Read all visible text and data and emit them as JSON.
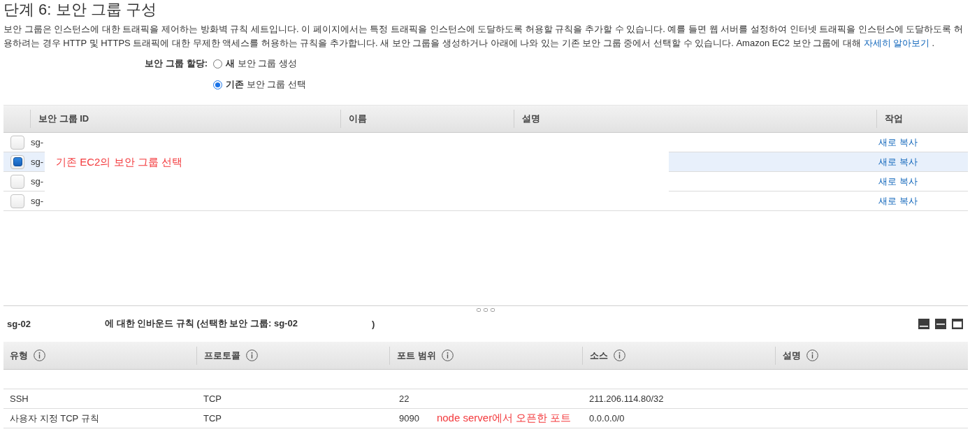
{
  "title": "단계 6: 보안 그룹 구성",
  "description": {
    "text": "보안 그룹은 인스턴스에 대한 트래픽을 제어하는 방화벽 규칙 세트입니다. 이 페이지에서는 특정 트래픽을 인스턴스에 도달하도록 허용할 규칙을 추가할 수 있습니다. 예를 들면 웹 서버를 설정하여 인터넷 트래픽을 인스턴스에 도달하도록 허용하려는 경우 HTTP 및 HTTPS 트래픽에 대한 무제한 액세스를 허용하는 규칙을 추가합니다. 새 보안 그룹을 생성하거나 아래에 나와 있는 기존 보안 그룹 중에서 선택할 수 있습니다. Amazon EC2 보안 그룹에 대해",
    "link": "자세히 알아보기",
    "after": "."
  },
  "assignment": {
    "label": "보안 그룹 할당:",
    "options": [
      {
        "label": "**새** 보안 그룹 생성",
        "selected": false
      },
      {
        "label": "**기존** 보안 그룹 선택",
        "selected": true
      }
    ]
  },
  "security_groups": {
    "columns": [
      "보안 그룹 ID",
      "이름",
      "설명",
      "작업"
    ],
    "rows": [
      {
        "id": "sg-",
        "action": "새로 복사",
        "selected": false
      },
      {
        "id": "sg-",
        "action": "새로 복사",
        "selected": true,
        "annotation": "기존 EC2의 보안 그룹 선택"
      },
      {
        "id": "sg-",
        "action": "새로 복사",
        "selected": false
      },
      {
        "id": "sg-",
        "action": "새로 복사",
        "selected": false
      }
    ]
  },
  "inbound_rules": {
    "heading": [
      "sg-02",
      "에 대한 인바운드 규칙 (선택한 보안 그룹: sg-02",
      ")"
    ],
    "columns": [
      "유형",
      "프로토콜",
      "포트 범위",
      "소스",
      "설명"
    ],
    "rows": [
      {
        "type": "SSH",
        "protocol": "TCP",
        "port_range": "22",
        "source": "211.206.114.80/32"
      },
      {
        "type": "사용자 지정 TCP 규칙",
        "protocol": "TCP",
        "port_range": "9090",
        "port_note": "node server에서 오픈한 포트",
        "source": "0.0.0.0/0"
      }
    ]
  }
}
